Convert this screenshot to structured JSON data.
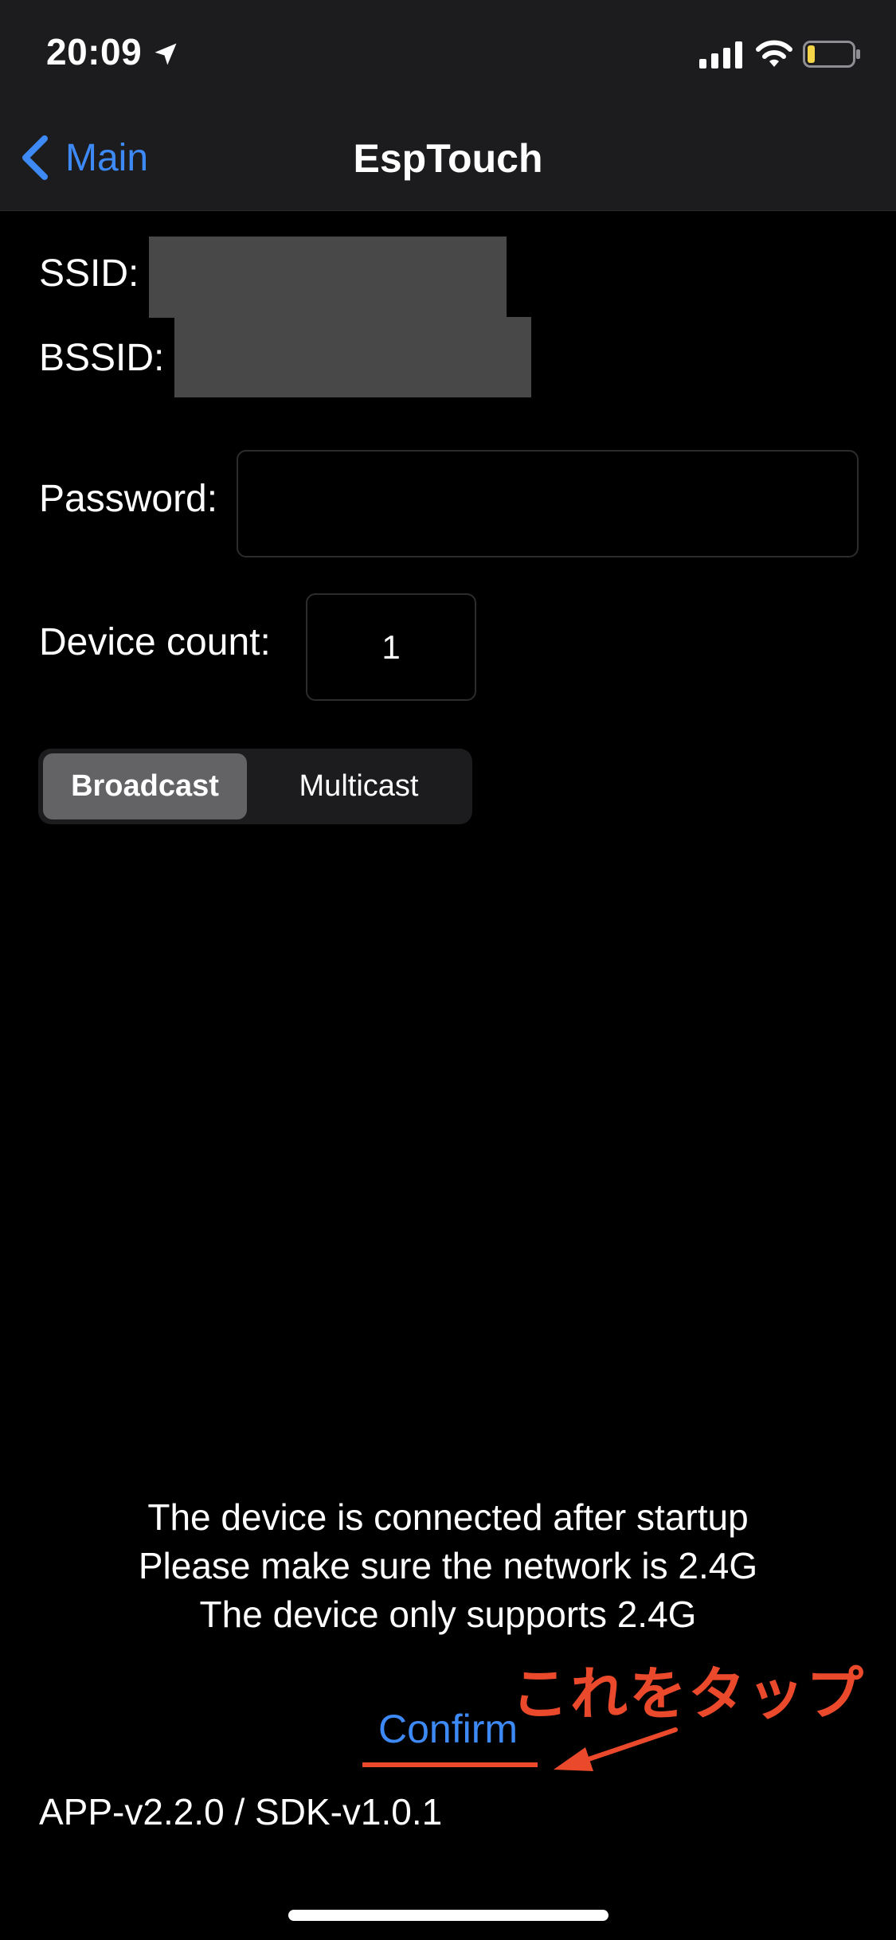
{
  "status_bar": {
    "time": "20:09",
    "icons": [
      "location-arrow-icon",
      "cellular-signal-icon",
      "wifi-icon",
      "battery-low-icon"
    ],
    "battery_color": "#f5d547"
  },
  "nav": {
    "back_label": "Main",
    "title": "EspTouch",
    "accent": "#3d8af7"
  },
  "form": {
    "ssid_label": "SSID:",
    "bssid_label": "BSSID:",
    "password_label": "Password:",
    "password_value": "",
    "device_count_label": "Device count:",
    "device_count_value": "1"
  },
  "mode": {
    "options": [
      "Broadcast",
      "Multicast"
    ],
    "selected": "Broadcast"
  },
  "info": {
    "lines": [
      "The device is connected after startup",
      "Please make sure the network is 2.4G",
      "The device only supports 2.4G"
    ]
  },
  "confirm_label": "Confirm",
  "annotation": {
    "text": "これをタップ",
    "color": "#ea4a2b"
  },
  "version": "APP-v2.2.0 / SDK-v1.0.1"
}
